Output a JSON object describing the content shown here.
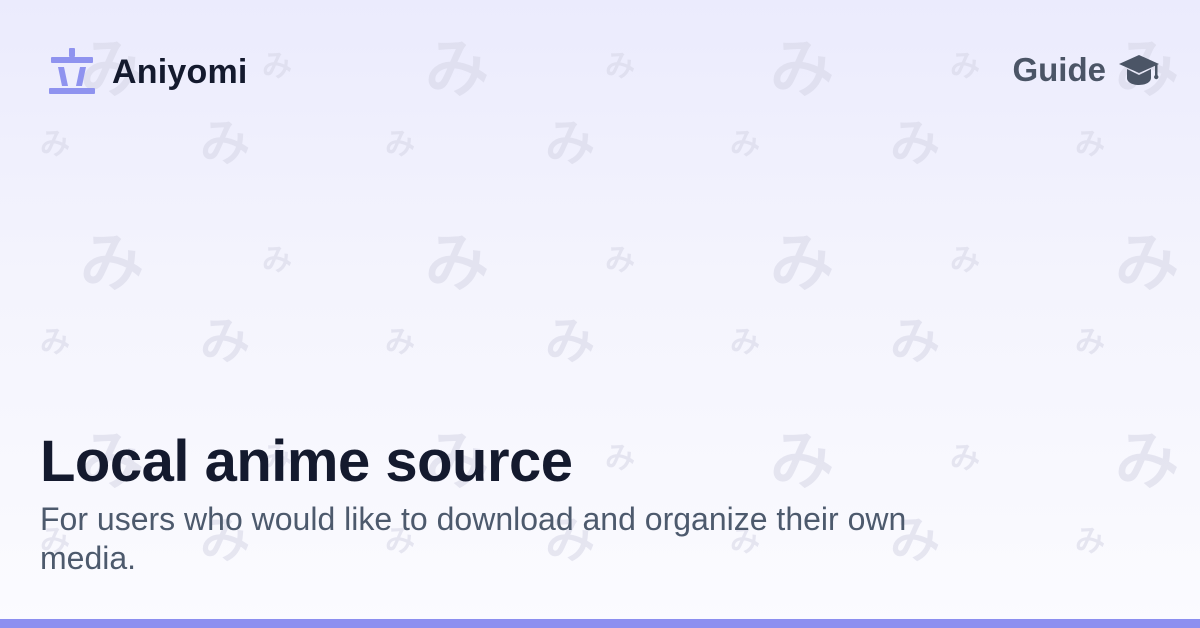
{
  "brand": {
    "name": "Aniyomi",
    "icon": "aniyomi-logo-icon"
  },
  "nav": {
    "guide_label": "Guide",
    "guide_icon": "graduation-cap-icon"
  },
  "hero": {
    "title": "Local anime source",
    "description": "For users who would like to download and organize their own media."
  },
  "theme": {
    "accent": "#8c8ff0",
    "logo_color": "#8f93ef",
    "title_color": "#141a2e",
    "text_color": "#4d5a6d",
    "pattern_color": "#d6d6e6"
  }
}
